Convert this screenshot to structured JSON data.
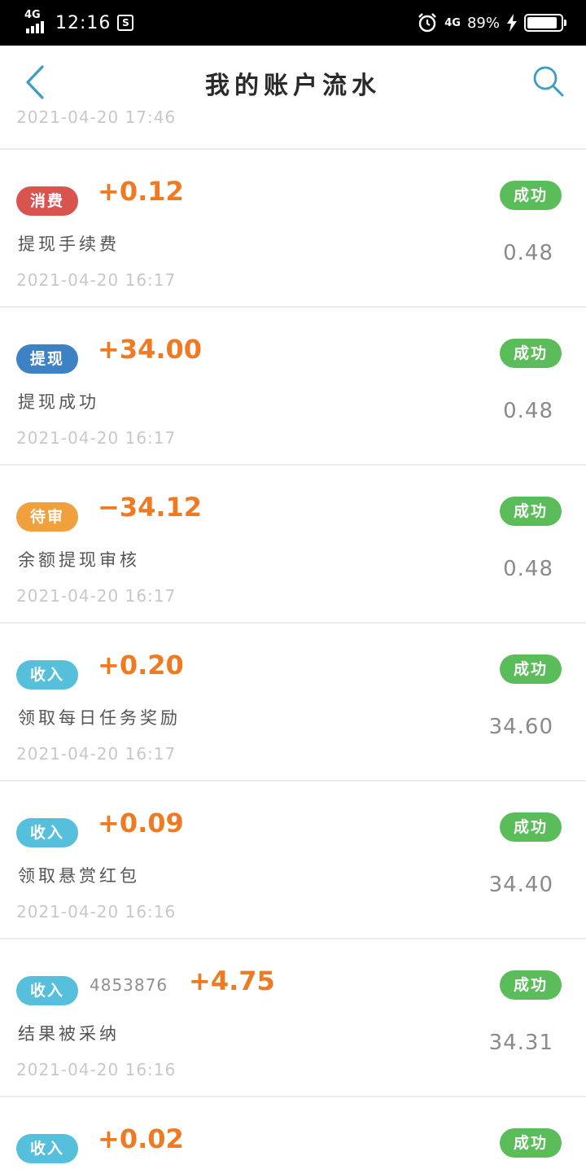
{
  "status_bar": {
    "network": "4G",
    "time": "12:16",
    "notification_glyph": "S",
    "network2": "4G",
    "battery_pct": "89%",
    "battery_level": 0.89
  },
  "header": {
    "title": "我的账户流水"
  },
  "partial_row": {
    "date": "2021-04-20 17:46"
  },
  "colors": {
    "consume": "#d9534f",
    "withdraw": "#3d82c4",
    "pending": "#f0a13e",
    "income": "#55bfdc",
    "success": "#5bbd59",
    "amount": "#f07a22"
  },
  "records": [
    {
      "type": "消费",
      "amount": "+0.12",
      "status": "成功",
      "description": "提现手续费",
      "balance": "0.48",
      "date": "2021-04-20 16:17"
    },
    {
      "type": "提现",
      "amount": "+34.00",
      "status": "成功",
      "description": "提现成功",
      "balance": "0.48",
      "date": "2021-04-20 16:17"
    },
    {
      "type": "待审",
      "amount": "−34.12",
      "status": "成功",
      "description": "余额提现审核",
      "balance": "0.48",
      "date": "2021-04-20 16:17"
    },
    {
      "type": "收入",
      "amount": "+0.20",
      "status": "成功",
      "description": "领取每日任务奖励",
      "balance": "34.60",
      "date": "2021-04-20 16:17"
    },
    {
      "type": "收入",
      "amount": "+0.09",
      "status": "成功",
      "description": "领取悬赏红包",
      "balance": "34.40",
      "date": "2021-04-20 16:16"
    },
    {
      "type": "收入",
      "ref": "4853876",
      "amount": "+4.75",
      "status": "成功",
      "description": "结果被采纳",
      "balance": "34.31",
      "date": "2021-04-20 16:16"
    },
    {
      "type": "收入",
      "amount": "+0.02",
      "status": "成功"
    }
  ]
}
